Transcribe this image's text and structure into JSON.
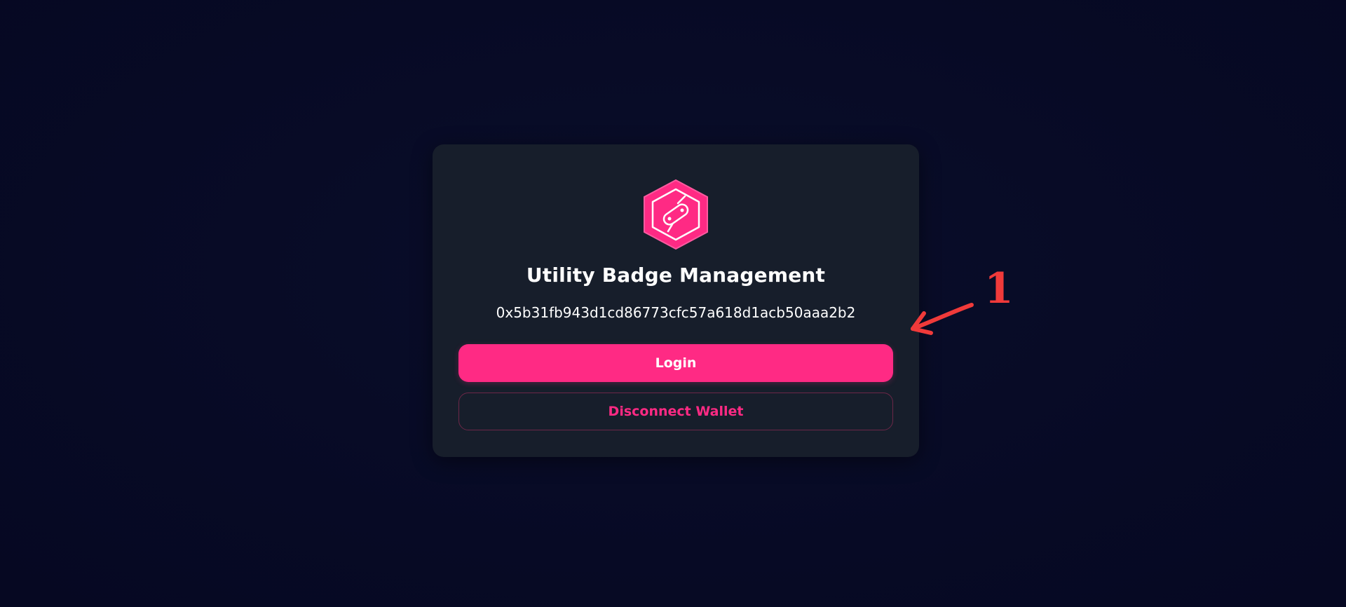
{
  "app": {
    "title": "Utility Badge Management",
    "wallet_address": "0x5b31fb943d1cd86773cfc57a618d1acb50aaa2b2"
  },
  "actions": {
    "login_label": "Login",
    "disconnect_label": "Disconnect Wallet"
  },
  "logo": {
    "icon": "badge-hexagon-icon"
  },
  "annotation": {
    "number": "1"
  },
  "colors": {
    "background": "#070a25",
    "card": "#171e2b",
    "accent": "#ff2a84",
    "annotation": "#f03a3a"
  }
}
